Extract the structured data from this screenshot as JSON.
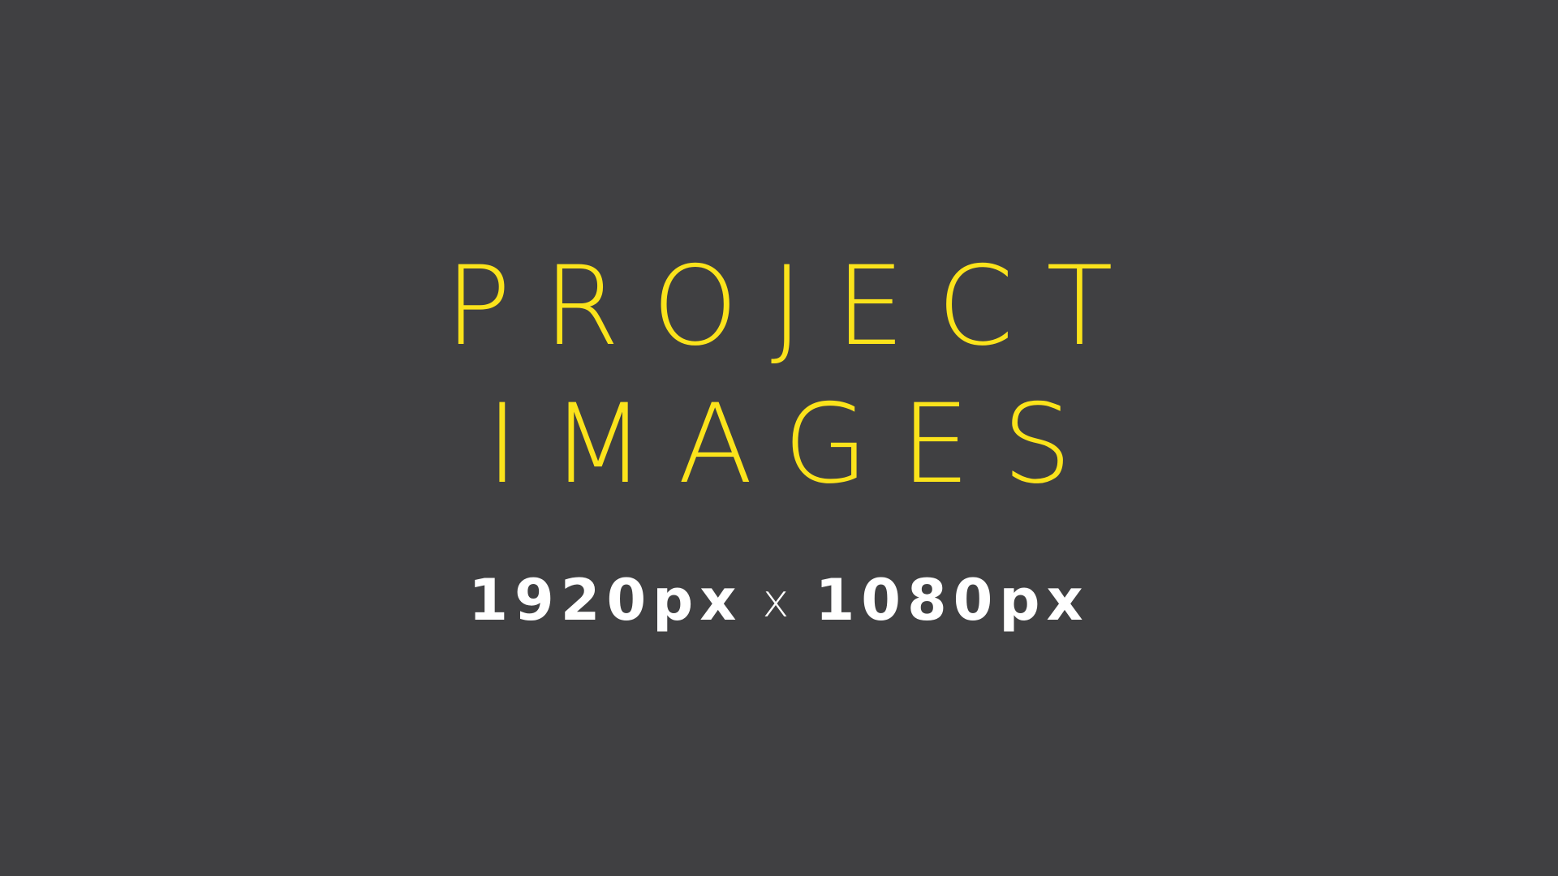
{
  "title": {
    "line1": "PROJECT",
    "line2": "IMAGES"
  },
  "dimensions": {
    "width_text": "1920px",
    "separator": "x",
    "height_text": "1080px"
  },
  "colors": {
    "background": "#404042",
    "title": "#fbe31b",
    "dimensions": "#ffffff"
  }
}
